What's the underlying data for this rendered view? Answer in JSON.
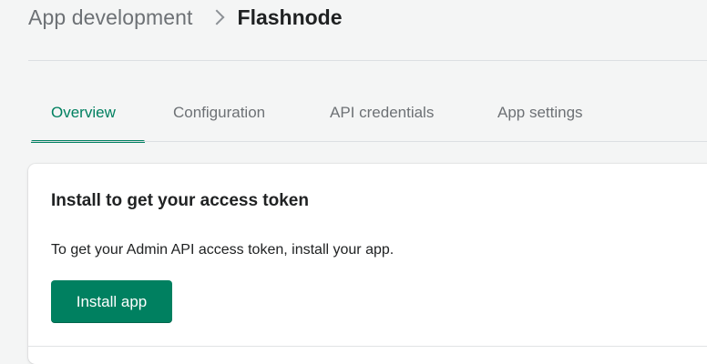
{
  "breadcrumb": {
    "parent": "App development",
    "current": "Flashnode"
  },
  "tabs": [
    {
      "label": "Overview",
      "active": true
    },
    {
      "label": "Configuration",
      "active": false
    },
    {
      "label": "API credentials",
      "active": false
    },
    {
      "label": "App settings",
      "active": false
    }
  ],
  "card": {
    "title": "Install to get your access token",
    "text": "To get your Admin API access token, install your app.",
    "button_label": "Install app"
  },
  "colors": {
    "accent": "#008060",
    "muted_text": "#6d7175",
    "text": "#202223",
    "background": "#f4f5f5"
  },
  "icons": {
    "breadcrumb_separator": "chevron-right-icon"
  }
}
